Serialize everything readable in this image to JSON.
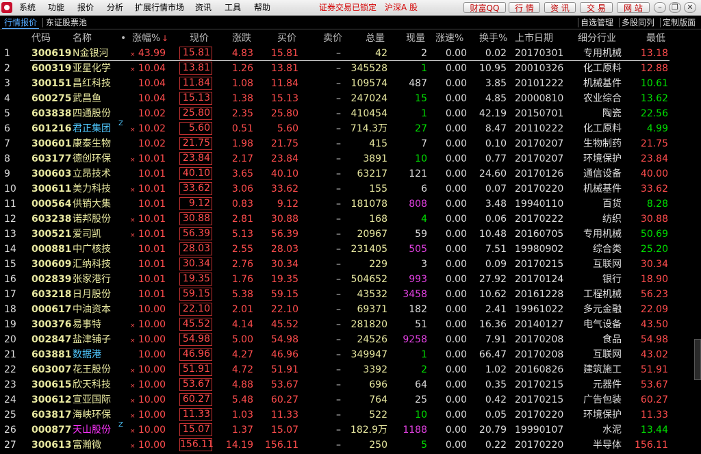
{
  "menubar": {
    "menus": [
      "系统",
      "功能",
      "报价",
      "分析",
      "扩展行情市场",
      "资讯",
      "工具",
      "帮助"
    ],
    "status_notice": "证券交易已锁定",
    "market_selector": "沪深A 股",
    "toolbar_buttons": [
      "财富QQ",
      "行 情",
      "资 讯",
      "交 易",
      "网 站"
    ],
    "window_controls": [
      "minimize-icon",
      "restore-icon",
      "close-icon"
    ]
  },
  "tabs": {
    "left": [
      "行情报价",
      "东证股票池"
    ],
    "right": [
      "自选管理",
      "多股同列",
      "定制版面"
    ]
  },
  "table": {
    "headers": [
      "代码",
      "名称",
      "涨幅%",
      "现价",
      "涨跌",
      "买价",
      "卖价",
      "总量",
      "现量",
      "涨速%",
      "换手%",
      "上市日期",
      "细分行业",
      "最低"
    ],
    "sort_indicator": "↓",
    "dot": "•",
    "star": "×",
    "zmark": "Z",
    "rows": [
      {
        "no": "1",
        "code": "300619",
        "name": "N金银河",
        "star": true,
        "pct": "43.99",
        "price": "15.81",
        "chg": "4.83",
        "bid": "15.81",
        "ask": "–",
        "vol": "42",
        "cur": "2",
        "curc": "gry",
        "speed": "0.00",
        "turn": "0.02",
        "date": "20170301",
        "ind": "专用机械",
        "low": "13.18",
        "lowc": "red"
      },
      {
        "no": "2",
        "code": "600319",
        "name": "亚星化学",
        "star": true,
        "pct": "10.04",
        "price": "13.81",
        "chg": "1.26",
        "bid": "13.81",
        "ask": "–",
        "vol": "345528",
        "cur": "1",
        "curc": "grn",
        "speed": "0.00",
        "turn": "10.95",
        "date": "20010326",
        "ind": "化工原料",
        "low": "12.88",
        "lowc": "red"
      },
      {
        "no": "3",
        "code": "300151",
        "name": "昌红科技",
        "star": false,
        "pct": "10.04",
        "price": "11.84",
        "chg": "1.08",
        "bid": "11.84",
        "ask": "–",
        "vol": "109574",
        "cur": "487",
        "curc": "gry",
        "speed": "0.00",
        "turn": "3.85",
        "date": "20101222",
        "ind": "机械基件",
        "low": "10.61",
        "lowc": "grn"
      },
      {
        "no": "4",
        "code": "600275",
        "name": "武昌鱼",
        "star": false,
        "pct": "10.04",
        "price": "15.13",
        "chg": "1.38",
        "bid": "15.13",
        "ask": "–",
        "vol": "247024",
        "cur": "15",
        "curc": "grn",
        "speed": "0.00",
        "turn": "4.85",
        "date": "20000810",
        "ind": "农业综合",
        "low": "13.62",
        "lowc": "grn"
      },
      {
        "no": "5",
        "code": "603838",
        "name": "四通股份",
        "star": false,
        "pct": "10.02",
        "price": "25.80",
        "chg": "2.35",
        "bid": "25.80",
        "ask": "–",
        "vol": "410454",
        "cur": "1",
        "curc": "grn",
        "speed": "0.00",
        "turn": "42.19",
        "date": "20150701",
        "ind": "陶瓷",
        "low": "22.56",
        "lowc": "grn"
      },
      {
        "no": "6",
        "code": "601216",
        "name": "君正集团",
        "nameColor": "blue",
        "z": true,
        "star": true,
        "pct": "10.02",
        "price": "5.60",
        "chg": "0.51",
        "bid": "5.60",
        "ask": "–",
        "vol": "714.3万",
        "cur": "27",
        "curc": "grn",
        "speed": "0.00",
        "turn": "8.47",
        "date": "20110222",
        "ind": "化工原料",
        "low": "4.99",
        "lowc": "grn"
      },
      {
        "no": "7",
        "code": "300601",
        "name": "康泰生物",
        "star": false,
        "pct": "10.02",
        "price": "21.75",
        "chg": "1.98",
        "bid": "21.75",
        "ask": "–",
        "vol": "415",
        "cur": "7",
        "curc": "gry",
        "speed": "0.00",
        "turn": "0.10",
        "date": "20170207",
        "ind": "生物制药",
        "low": "21.75",
        "lowc": "red"
      },
      {
        "no": "8",
        "code": "603177",
        "name": "德创环保",
        "star": true,
        "pct": "10.01",
        "price": "23.84",
        "chg": "2.17",
        "bid": "23.84",
        "ask": "–",
        "vol": "3891",
        "cur": "10",
        "curc": "grn",
        "speed": "0.00",
        "turn": "0.77",
        "date": "20170207",
        "ind": "环境保护",
        "low": "23.84",
        "lowc": "red"
      },
      {
        "no": "9",
        "code": "300603",
        "name": "立昂技术",
        "star": false,
        "pct": "10.01",
        "price": "40.10",
        "chg": "3.65",
        "bid": "40.10",
        "ask": "–",
        "vol": "63217",
        "cur": "121",
        "curc": "gry",
        "speed": "0.00",
        "turn": "24.60",
        "date": "20170126",
        "ind": "通信设备",
        "low": "40.00",
        "lowc": "red"
      },
      {
        "no": "10",
        "code": "300611",
        "name": "美力科技",
        "star": true,
        "pct": "10.01",
        "price": "33.62",
        "chg": "3.06",
        "bid": "33.62",
        "ask": "–",
        "vol": "155",
        "cur": "6",
        "curc": "gry",
        "speed": "0.00",
        "turn": "0.07",
        "date": "20170220",
        "ind": "机械基件",
        "low": "33.62",
        "lowc": "red"
      },
      {
        "no": "11",
        "code": "000564",
        "name": "供销大集",
        "star": false,
        "pct": "10.01",
        "price": "9.12",
        "chg": "0.83",
        "bid": "9.12",
        "ask": "–",
        "vol": "181078",
        "cur": "808",
        "curc": "mag",
        "speed": "0.00",
        "turn": "3.48",
        "date": "19940110",
        "ind": "百货",
        "low": "8.28",
        "lowc": "grn"
      },
      {
        "no": "12",
        "code": "603238",
        "name": "诺邦股份",
        "star": true,
        "pct": "10.01",
        "price": "30.88",
        "chg": "2.81",
        "bid": "30.88",
        "ask": "–",
        "vol": "168",
        "cur": "4",
        "curc": "grn",
        "speed": "0.00",
        "turn": "0.06",
        "date": "20170222",
        "ind": "纺织",
        "low": "30.88",
        "lowc": "red"
      },
      {
        "no": "13",
        "code": "300521",
        "name": "爱司凯",
        "star": true,
        "pct": "10.01",
        "price": "56.39",
        "chg": "5.13",
        "bid": "56.39",
        "ask": "–",
        "vol": "20967",
        "cur": "59",
        "curc": "gry",
        "speed": "0.00",
        "turn": "10.48",
        "date": "20160705",
        "ind": "专用机械",
        "low": "50.69",
        "lowc": "grn"
      },
      {
        "no": "14",
        "code": "000881",
        "name": "中广核技",
        "star": false,
        "pct": "10.01",
        "price": "28.03",
        "chg": "2.55",
        "bid": "28.03",
        "ask": "–",
        "vol": "231405",
        "cur": "505",
        "curc": "mag",
        "speed": "0.00",
        "turn": "7.51",
        "date": "19980902",
        "ind": "综合类",
        "low": "25.20",
        "lowc": "grn"
      },
      {
        "no": "15",
        "code": "300609",
        "name": "汇纳科技",
        "star": false,
        "pct": "10.01",
        "price": "30.34",
        "chg": "2.76",
        "bid": "30.34",
        "ask": "–",
        "vol": "229",
        "cur": "3",
        "curc": "gry",
        "speed": "0.00",
        "turn": "0.09",
        "date": "20170215",
        "ind": "互联网",
        "low": "30.34",
        "lowc": "red"
      },
      {
        "no": "16",
        "code": "002839",
        "name": "张家港行",
        "star": false,
        "pct": "10.01",
        "price": "19.35",
        "chg": "1.76",
        "bid": "19.35",
        "ask": "–",
        "vol": "504652",
        "cur": "993",
        "curc": "mag",
        "speed": "0.00",
        "turn": "27.92",
        "date": "20170124",
        "ind": "银行",
        "low": "18.90",
        "lowc": "red"
      },
      {
        "no": "17",
        "code": "603218",
        "name": "日月股份",
        "star": false,
        "pct": "10.01",
        "price": "59.15",
        "chg": "5.38",
        "bid": "59.15",
        "ask": "–",
        "vol": "43532",
        "cur": "3458",
        "curc": "mag",
        "speed": "0.00",
        "turn": "10.62",
        "date": "20161228",
        "ind": "工程机械",
        "low": "56.23",
        "lowc": "red"
      },
      {
        "no": "18",
        "code": "000617",
        "name": "中油资本",
        "star": false,
        "pct": "10.00",
        "price": "22.10",
        "chg": "2.01",
        "bid": "22.10",
        "ask": "–",
        "vol": "69371",
        "cur": "182",
        "curc": "gry",
        "speed": "0.00",
        "turn": "2.41",
        "date": "19961022",
        "ind": "多元金融",
        "low": "22.09",
        "lowc": "red"
      },
      {
        "no": "19",
        "code": "300376",
        "name": "易事特",
        "star": true,
        "pct": "10.00",
        "price": "45.52",
        "chg": "4.14",
        "bid": "45.52",
        "ask": "–",
        "vol": "281820",
        "cur": "51",
        "curc": "gry",
        "speed": "0.00",
        "turn": "16.36",
        "date": "20140127",
        "ind": "电气设备",
        "low": "43.50",
        "lowc": "red"
      },
      {
        "no": "20",
        "code": "002847",
        "name": "盐津铺子",
        "star": true,
        "pct": "10.00",
        "price": "54.98",
        "chg": "5.00",
        "bid": "54.98",
        "ask": "–",
        "vol": "24526",
        "cur": "9258",
        "curc": "mag",
        "speed": "0.00",
        "turn": "7.91",
        "date": "20170208",
        "ind": "食品",
        "low": "54.98",
        "lowc": "red"
      },
      {
        "no": "21",
        "code": "603881",
        "name": "数据港",
        "nameColor": "blue",
        "star": false,
        "pct": "10.00",
        "price": "46.96",
        "chg": "4.27",
        "bid": "46.96",
        "ask": "–",
        "vol": "349947",
        "cur": "1",
        "curc": "grn",
        "speed": "0.00",
        "turn": "66.47",
        "date": "20170208",
        "ind": "互联网",
        "low": "43.02",
        "lowc": "red"
      },
      {
        "no": "22",
        "code": "603007",
        "name": "花王股份",
        "star": true,
        "pct": "10.00",
        "price": "51.91",
        "chg": "4.72",
        "bid": "51.91",
        "ask": "–",
        "vol": "3392",
        "cur": "2",
        "curc": "grn",
        "speed": "0.00",
        "turn": "1.02",
        "date": "20160826",
        "ind": "建筑施工",
        "low": "51.91",
        "lowc": "red"
      },
      {
        "no": "23",
        "code": "300615",
        "name": "欣天科技",
        "star": true,
        "pct": "10.00",
        "price": "53.67",
        "chg": "4.88",
        "bid": "53.67",
        "ask": "–",
        "vol": "696",
        "cur": "64",
        "curc": "gry",
        "speed": "0.00",
        "turn": "0.35",
        "date": "20170215",
        "ind": "元器件",
        "low": "53.67",
        "lowc": "red"
      },
      {
        "no": "24",
        "code": "300612",
        "name": "宣亚国际",
        "star": true,
        "pct": "10.00",
        "price": "60.27",
        "chg": "5.48",
        "bid": "60.27",
        "ask": "–",
        "vol": "764",
        "cur": "25",
        "curc": "gry",
        "speed": "0.00",
        "turn": "0.42",
        "date": "20170215",
        "ind": "广告包装",
        "low": "60.27",
        "lowc": "red"
      },
      {
        "no": "25",
        "code": "603817",
        "name": "海峡环保",
        "star": true,
        "pct": "10.00",
        "price": "11.33",
        "chg": "1.03",
        "bid": "11.33",
        "ask": "–",
        "vol": "522",
        "cur": "10",
        "curc": "grn",
        "speed": "0.00",
        "turn": "0.05",
        "date": "20170220",
        "ind": "环境保护",
        "low": "11.33",
        "lowc": "red"
      },
      {
        "no": "26",
        "code": "000877",
        "name": "天山股份",
        "nameColor": "mag",
        "z": true,
        "star": true,
        "pct": "10.00",
        "price": "15.07",
        "chg": "1.37",
        "bid": "15.07",
        "ask": "–",
        "vol": "182.9万",
        "cur": "1188",
        "curc": "mag",
        "speed": "0.00",
        "turn": "20.79",
        "date": "19990107",
        "ind": "水泥",
        "low": "13.44",
        "lowc": "grn"
      },
      {
        "no": "27",
        "code": "300613",
        "name": "富瀚微",
        "star": true,
        "pct": "10.00",
        "price": "156.11",
        "chg": "14.19",
        "bid": "156.11",
        "ask": "–",
        "vol": "250",
        "cur": "5",
        "curc": "grn",
        "speed": "0.00",
        "turn": "0.22",
        "date": "20170220",
        "ind": "半导体",
        "low": "156.11",
        "lowc": "red"
      }
    ]
  }
}
